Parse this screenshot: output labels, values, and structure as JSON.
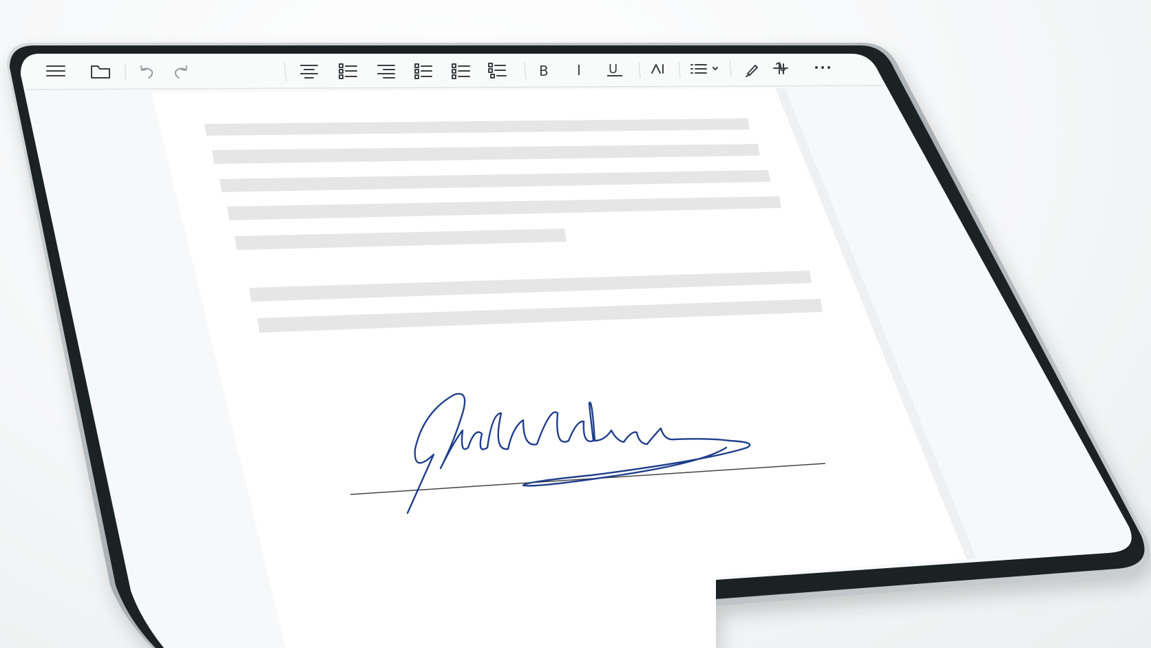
{
  "toolbar": {
    "icons": [
      {
        "name": "menu-icon",
        "state": "enabled"
      },
      {
        "name": "folder-icon",
        "state": "enabled"
      },
      {
        "name": "undo-icon",
        "state": "disabled"
      },
      {
        "name": "redo-icon",
        "state": "disabled"
      },
      {
        "name": "align-center-icon",
        "state": "enabled"
      },
      {
        "name": "checklist-icon",
        "state": "enabled"
      },
      {
        "name": "align-right-icon",
        "state": "enabled"
      },
      {
        "name": "checklist-alt-icon",
        "state": "enabled"
      },
      {
        "name": "task-list-icon",
        "state": "enabled"
      },
      {
        "name": "task-list-alt-icon",
        "state": "enabled"
      },
      {
        "name": "bold-icon",
        "label": "B",
        "state": "enabled"
      },
      {
        "name": "italic-icon",
        "label": "I",
        "state": "enabled"
      },
      {
        "name": "underline-icon",
        "label": "U",
        "state": "enabled"
      },
      {
        "name": "text-style-icon",
        "state": "enabled"
      },
      {
        "name": "list-style-icon",
        "state": "enabled"
      },
      {
        "name": "pen-icon",
        "state": "enabled"
      },
      {
        "name": "symbol-icon",
        "state": "enabled"
      },
      {
        "name": "more-icon",
        "state": "enabled"
      }
    ]
  },
  "document": {
    "text_lines_placeholder_count": 7,
    "signature": {
      "color": "#1f3f8c",
      "line_color": "#444444"
    }
  },
  "colors": {
    "bezel": "#1c2224",
    "frame": "#b9bec2",
    "screen": "#f7f8f9",
    "page": "#ffffff",
    "placeholder_line": "#e6e6e6"
  }
}
